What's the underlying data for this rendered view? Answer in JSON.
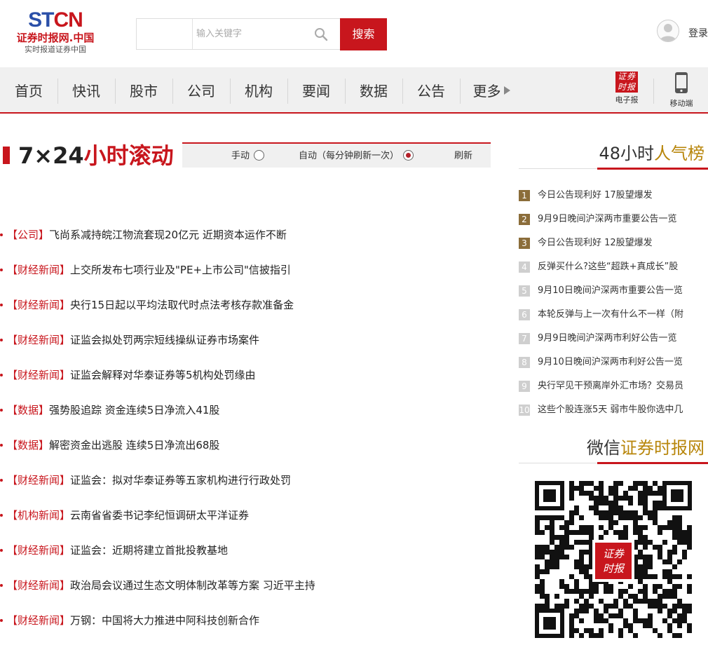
{
  "header": {
    "logo": {
      "mark_left": "ST",
      "mark_right": "CN",
      "name": "证券时报网.中国",
      "slogan": "实时报道证券中国"
    },
    "search": {
      "placeholder": "输入关键字",
      "button_label": "搜索"
    },
    "login_label": "登录"
  },
  "nav": {
    "items": [
      "首页",
      "快讯",
      "股市",
      "公司",
      "机构",
      "要闻",
      "数据",
      "公告",
      "更多"
    ],
    "tools": [
      {
        "label": "电子报",
        "icon": "epaper-icon"
      },
      {
        "label": "移动端",
        "icon": "mobile-icon"
      }
    ]
  },
  "titlebar": {
    "title_prefix": "7×24",
    "title_suffix": "小时滚动",
    "options": [
      {
        "label": "手动",
        "checked": false
      },
      {
        "label": "自动（每分钟刷新一次）",
        "checked": true
      }
    ],
    "refresh_label": "刷新"
  },
  "news": [
    {
      "category": "【公司】",
      "title": "飞尚系减持皖江物流套现20亿元 近期资本运作不断"
    },
    {
      "category": "【财经新闻】",
      "title": "上交所发布七项行业及\"PE+上市公司\"信披指引"
    },
    {
      "category": "【财经新闻】",
      "title": "央行15日起以平均法取代时点法考核存款准备金"
    },
    {
      "category": "【财经新闻】",
      "title": "证监会拟处罚两宗短线操纵证券市场案件"
    },
    {
      "category": "【财经新闻】",
      "title": "证监会解释对华泰证券等5机构处罚缘由"
    },
    {
      "category": "【数据】",
      "title": "强势股追踪 资金连续5日净流入41股"
    },
    {
      "category": "【数据】",
      "title": "解密资金出逃股 连续5日净流出68股"
    },
    {
      "category": "【财经新闻】",
      "title": "证监会：拟对华泰证券等五家机构进行行政处罚"
    },
    {
      "category": "【机构新闻】",
      "title": "云南省省委书记李纪恒调研太平洋证券"
    },
    {
      "category": "【财经新闻】",
      "title": "证监会：近期将建立首批投教基地"
    },
    {
      "category": "【财经新闻】",
      "title": "政治局会议通过生态文明体制改革等方案 习近平主持"
    },
    {
      "category": "【财经新闻】",
      "title": "万钢：中国将大力推进中阿科技创新合作"
    }
  ],
  "sidebar": {
    "ranking_title_prefix": "48小时",
    "ranking_title_suffix": "人气榜",
    "ranking": [
      {
        "rank": "1",
        "title": "今日公告现利好 17股望爆发"
      },
      {
        "rank": "2",
        "title": "9月9日晚间沪深两市重要公告一览"
      },
      {
        "rank": "3",
        "title": "今日公告现利好 12股望爆发"
      },
      {
        "rank": "4",
        "title": "反弹买什么?这些“超跌+真成长”股"
      },
      {
        "rank": "5",
        "title": "9月10日晚间沪深两市重要公告一览"
      },
      {
        "rank": "6",
        "title": "本轮反弹与上一次有什么不一样（附"
      },
      {
        "rank": "7",
        "title": "9月9日晚间沪深两市利好公告一览"
      },
      {
        "rank": "8",
        "title": "9月10日晚间沪深两市利好公告一览"
      },
      {
        "rank": "9",
        "title": "央行罕见干预离岸外汇市场？交易员"
      },
      {
        "rank": "10",
        "title": "这些个股连涨5天 弱市牛股你选中几"
      }
    ],
    "wechat_title_prefix": "微信",
    "wechat_title_suffix": "证券时报网",
    "qr_stamp_text": "证券时报"
  },
  "colors": {
    "accent": "#c8161d",
    "brand_blue": "#2a4fa8",
    "rank_top": "#8b6d3a",
    "rank_rest": "#cfcfcf"
  }
}
